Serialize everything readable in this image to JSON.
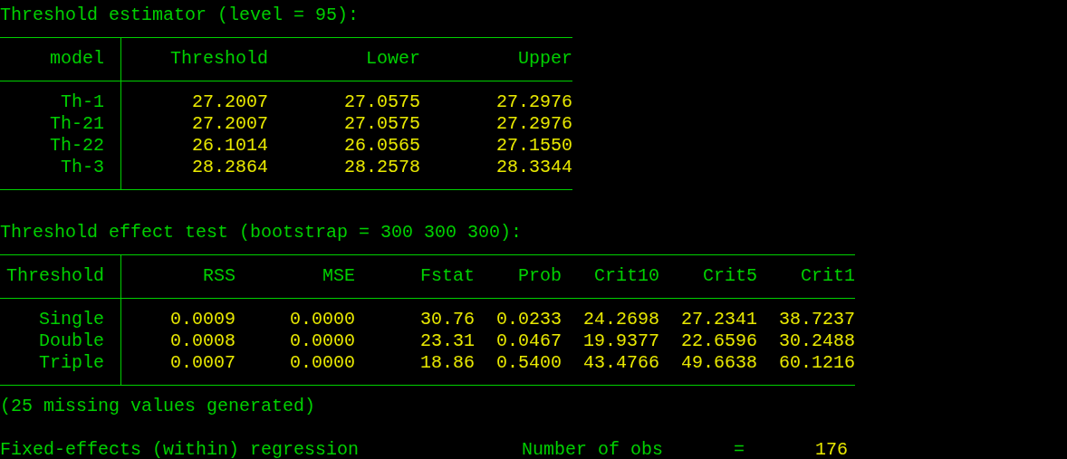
{
  "tables": [
    {
      "title": "Threshold estimator (level = 95):",
      "columns": [
        "model",
        "Threshold",
        "Lower",
        "Upper"
      ],
      "rows": [
        [
          "Th-1",
          "27.2007",
          "27.0575",
          "27.2976"
        ],
        [
          "Th-21",
          "27.2007",
          "27.0575",
          "27.2976"
        ],
        [
          "Th-22",
          "26.1014",
          "26.0565",
          "27.1550"
        ],
        [
          "Th-3",
          "28.2864",
          "28.2578",
          "28.3344"
        ]
      ]
    },
    {
      "title": "Threshold effect test (bootstrap = 300 300 300):",
      "columns": [
        "Threshold",
        "RSS",
        "MSE",
        "Fstat",
        "Prob",
        "Crit10",
        "Crit5",
        "Crit1"
      ],
      "rows": [
        [
          "Single",
          "0.0009",
          "0.0000",
          "30.76",
          "0.0233",
          "24.2698",
          "27.2341",
          "38.7237"
        ],
        [
          "Double",
          "0.0008",
          "0.0000",
          "23.31",
          "0.0467",
          "19.9377",
          "22.6596",
          "30.2488"
        ],
        [
          "Triple",
          "0.0007",
          "0.0000",
          "18.86",
          "0.5400",
          "43.4766",
          "49.6638",
          "60.1216"
        ]
      ]
    }
  ],
  "note": "(25 missing values generated)",
  "regression": {
    "title": "Fixed-effects (within) regression",
    "stat_label": "Number of obs",
    "equals": "=",
    "value": "176"
  }
}
